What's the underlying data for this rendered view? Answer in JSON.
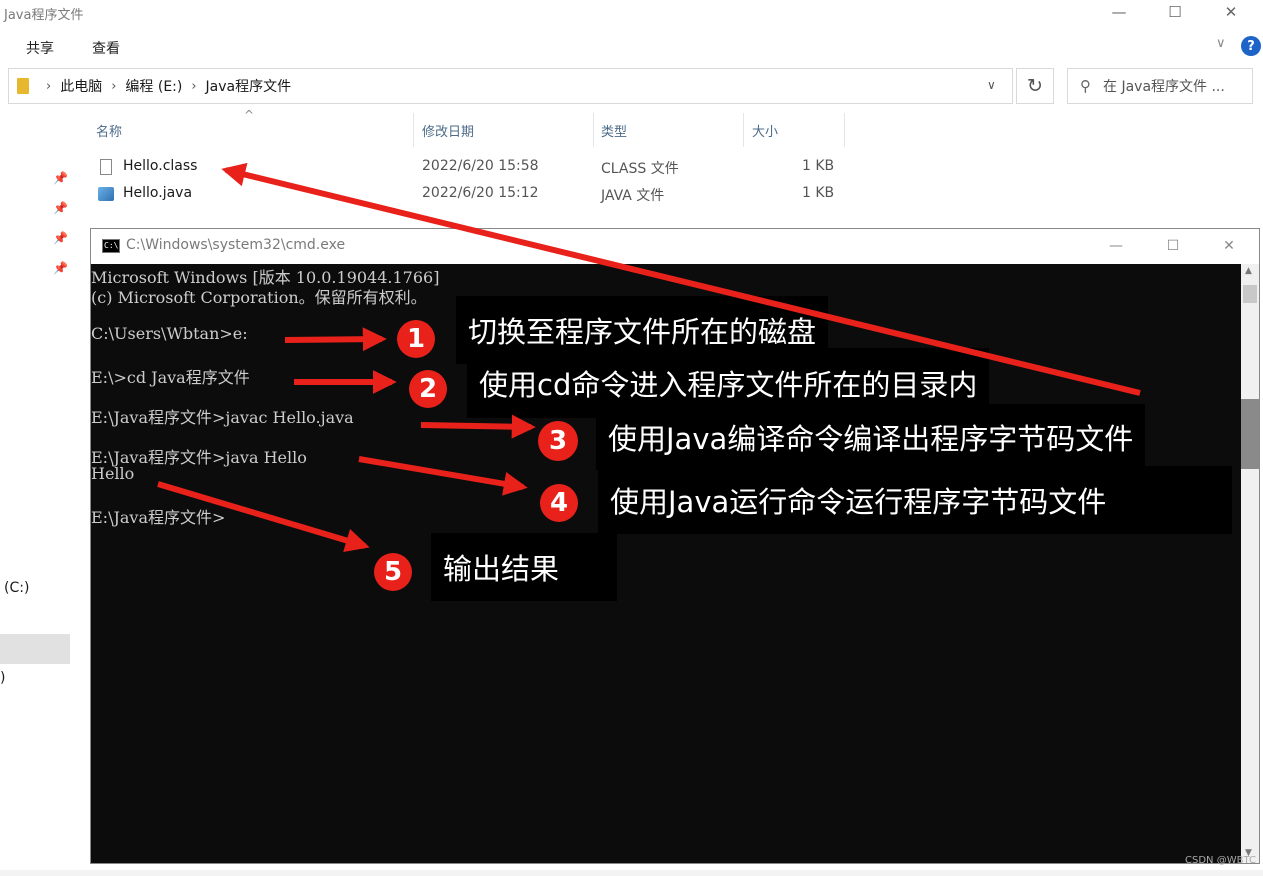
{
  "explorer": {
    "title": "Java程序文件",
    "window_controls": {
      "minimize": "—",
      "maximize": "☐",
      "close": "✕"
    },
    "ribbon_tabs": [
      "共享",
      "查看"
    ],
    "ribbon_expand": "∨",
    "help": "?",
    "breadcrumb": [
      "此电脑",
      "编程 (E:)",
      "Java程序文件"
    ],
    "search_placeholder": "在 Java程序文件 ...",
    "columns": {
      "name": "名称",
      "date": "修改日期",
      "type": "类型",
      "size": "大小"
    },
    "files": [
      {
        "name": "Hello.class",
        "date": "2022/6/20 15:58",
        "type": "CLASS 文件",
        "size": "1 KB",
        "icon": "class-file-icon"
      },
      {
        "name": "Hello.java",
        "date": "2022/6/20 15:12",
        "type": "JAVA 文件",
        "size": "1 KB",
        "icon": "java-file-icon"
      }
    ],
    "nav": {
      "drive_c": "(C:)",
      "partial": ")"
    }
  },
  "cmd": {
    "title": "C:\\Windows\\system32\\cmd.exe",
    "icon_text": "C:\\",
    "controls": {
      "minimize": "—",
      "maximize": "☐",
      "close": "✕"
    },
    "lines": [
      "Microsoft Windows [版本 10.0.19044.1766]",
      "(c) Microsoft Corporation。保留所有权利。",
      "",
      "C:\\Users\\Wbtan>e:",
      "",
      "E:\\>cd Java程序文件",
      "",
      "E:\\Java程序文件>javac Hello.java",
      "",
      "E:\\Java程序文件>java Hello",
      "Hello",
      "",
      "E:\\Java程序文件>"
    ]
  },
  "annotations": [
    {
      "num": "1",
      "text": "切换至程序文件所在的磁盘"
    },
    {
      "num": "2",
      "text": "使用cd命令进入程序文件所在的目录内"
    },
    {
      "num": "3",
      "text": "使用Java编译命令编译出程序字节码文件"
    },
    {
      "num": "4",
      "text": "使用Java运行命令运行程序字节码文件"
    },
    {
      "num": "5",
      "text": "输出结果"
    }
  ],
  "colors": {
    "arrow": "#e8221a",
    "badge": "#e8221a",
    "terminal_bg": "#0c0c0c",
    "terminal_text": "#cccccc"
  },
  "watermark": "CSDN @WBTC"
}
